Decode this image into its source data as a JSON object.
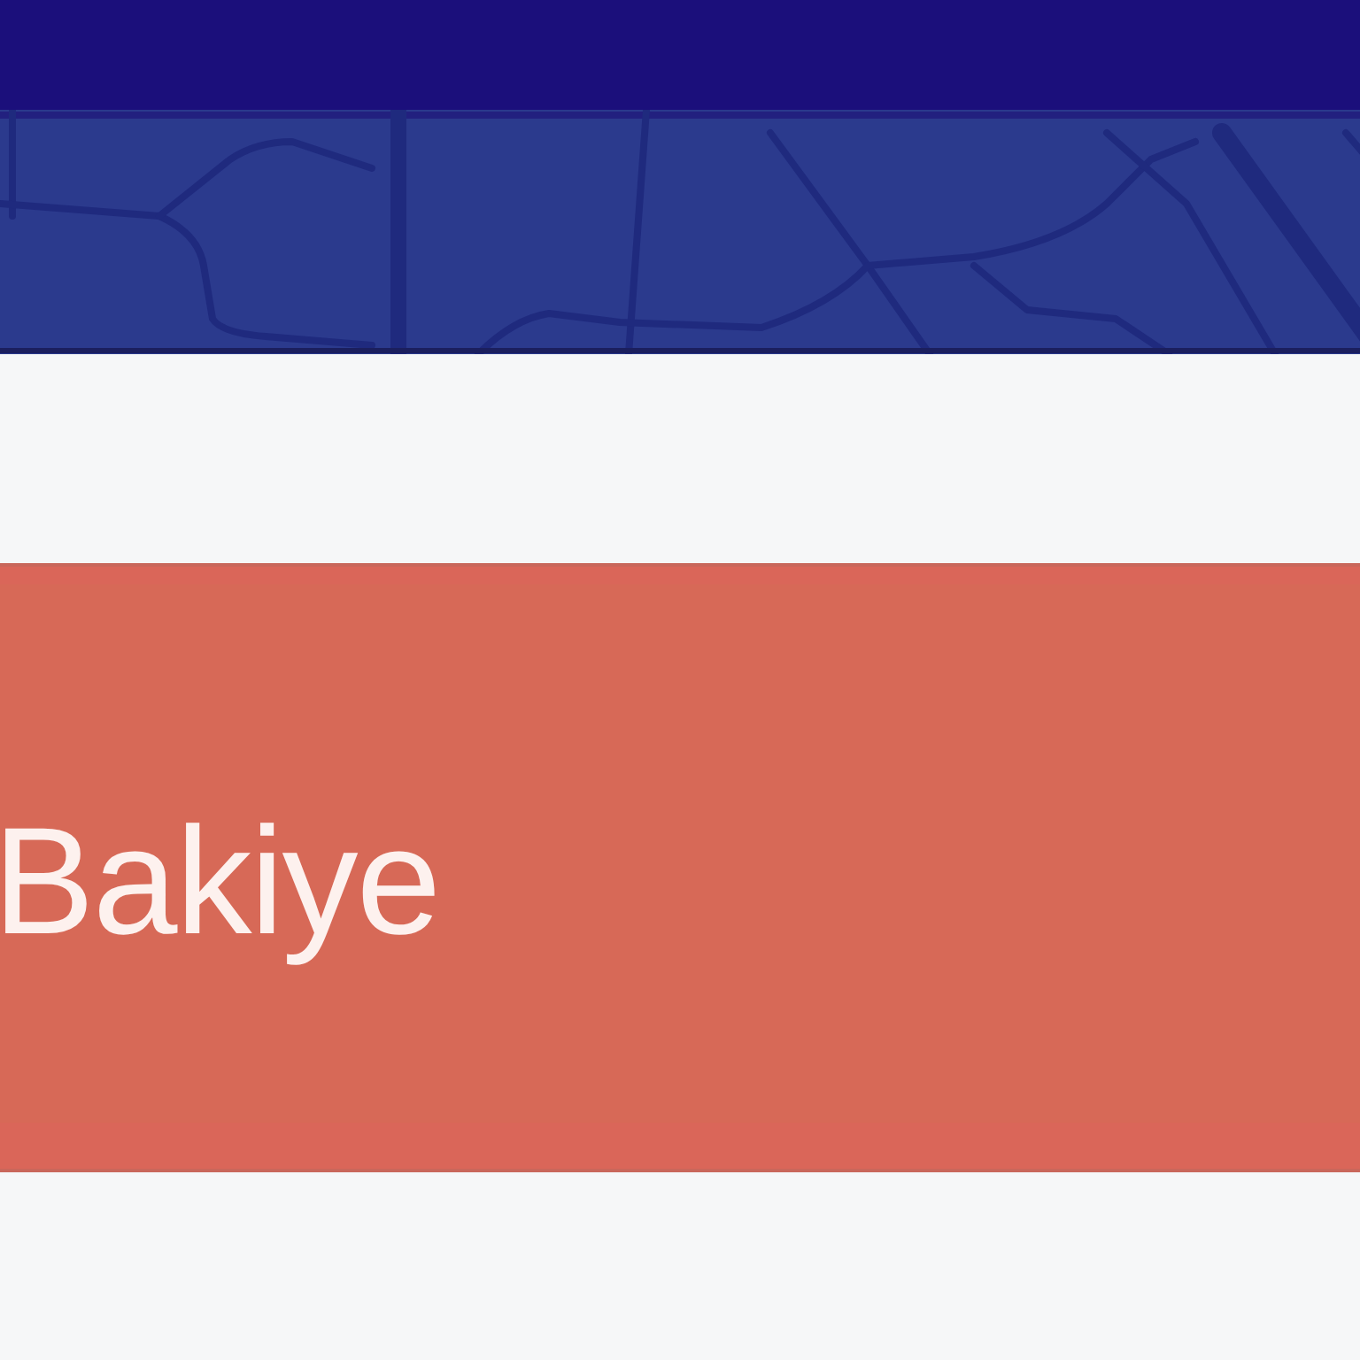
{
  "balance_card": {
    "label": "Bakiye"
  }
}
